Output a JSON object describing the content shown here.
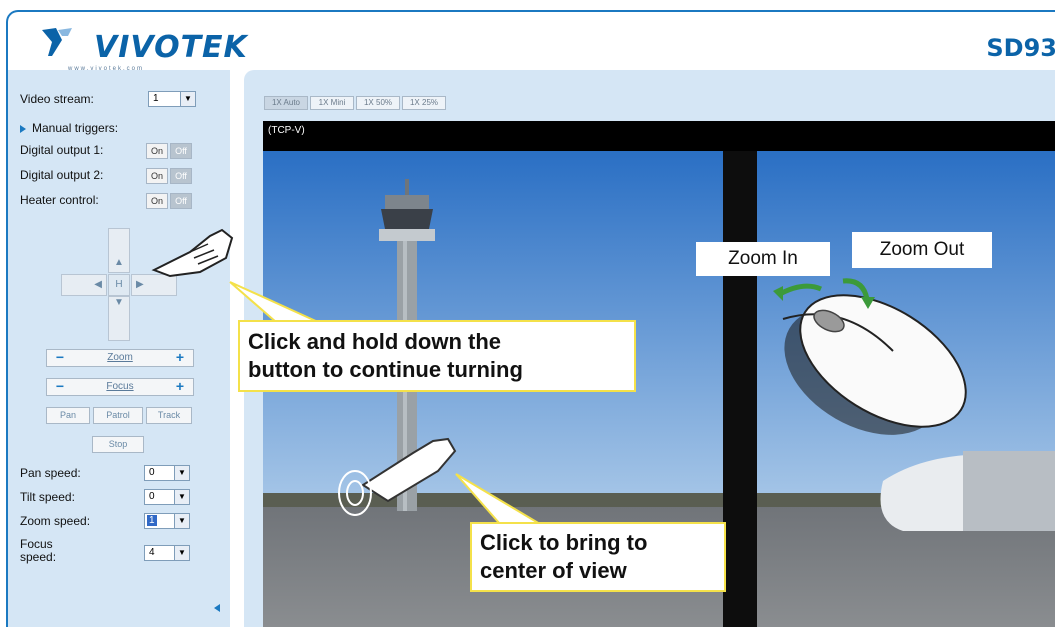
{
  "header": {
    "brand": "VIVOTEK",
    "brand_url": "www.vivotek.com",
    "model": "SD93"
  },
  "sidebar": {
    "video_stream_label": "Video stream:",
    "video_stream_value": "1",
    "manual_triggers_label": "Manual triggers:",
    "digital_output_1_label": "Digital output 1:",
    "digital_output_2_label": "Digital output 2:",
    "heater_control_label": "Heater control:",
    "on_label": "On",
    "off_label": "Off",
    "home_label": "H",
    "zoom_label": "Zoom",
    "focus_label": "Focus",
    "minus": "−",
    "plus": "+",
    "pan_label": "Pan",
    "patrol_label": "Patrol",
    "track_label": "Track",
    "stop_label": "Stop",
    "pan_speed_label": "Pan speed:",
    "pan_speed_value": "0",
    "tilt_speed_label": "Tilt speed:",
    "tilt_speed_value": "0",
    "zoom_speed_label": "Zoom speed:",
    "zoom_speed_value": "1",
    "focus_speed_label": "Focus speed:",
    "focus_speed_value": "4"
  },
  "viewer": {
    "tabs": [
      "1X Auto",
      "1X Mini",
      "1X 50%",
      "1X 25%"
    ],
    "protocol": "(TCP-V)"
  },
  "annotations": {
    "hold_callout_line1": "Click and hold down the",
    "hold_callout_line2": "button to continue turning",
    "center_callout_line1": "Click to bring to",
    "center_callout_line2": "center of view",
    "zoom_in": "Zoom In",
    "zoom_out": "Zoom Out"
  },
  "colors": {
    "accent": "#1b79c1",
    "panel": "#d5e6f5",
    "callout_border": "#f4e14a"
  }
}
